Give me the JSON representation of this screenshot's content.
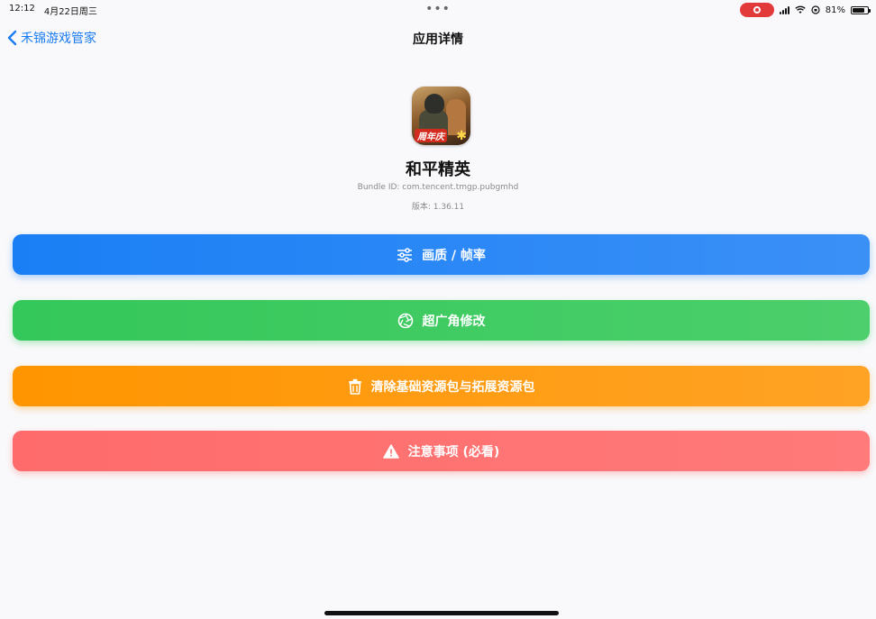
{
  "status_bar": {
    "time": "12:12",
    "date": "4月22日周三",
    "battery": "81%",
    "battery_level": 0.81
  },
  "nav": {
    "back_label": "禾锦游戏管家",
    "title": "应用详情"
  },
  "app": {
    "name": "和平精英",
    "bundle_id": "Bundle ID: com.tencent.tmgp.pubgmhd",
    "version": "版本: 1.36.11",
    "icon_badge": "周年庆"
  },
  "actions": [
    {
      "label": "画质 / 帧率",
      "icon": "sliders-icon",
      "color": "#1a7ff5"
    },
    {
      "label": "超广角修改",
      "icon": "aperture-icon",
      "color": "#34c759"
    },
    {
      "label": "清除基础资源包与拓展资源包",
      "icon": "trash-icon",
      "color": "#ff9500"
    },
    {
      "label": "注意事项 (必看)",
      "icon": "warning-icon",
      "color": "#ff6b6b"
    }
  ],
  "colors": {
    "accent": "#1a7cf2",
    "record": "#e23a3a"
  }
}
